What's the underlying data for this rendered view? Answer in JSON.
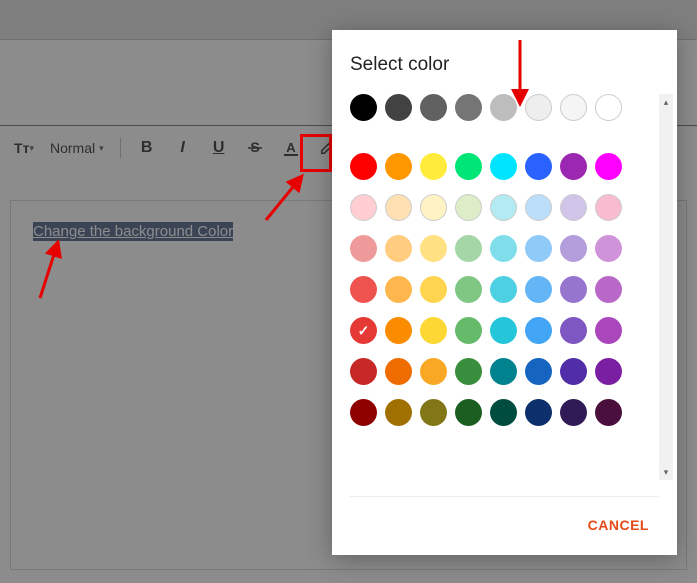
{
  "toolbar": {
    "font_size_icon": "Tт",
    "format_label": "Normal",
    "bold": "B",
    "italic": "I",
    "underline": "U"
  },
  "editor": {
    "selected_text": "Change the background Color"
  },
  "dialog": {
    "title": "Select color",
    "cancel_label": "CANCEL",
    "selected_color": "#e53935",
    "rows": [
      [
        {
          "c": "#000000"
        },
        {
          "c": "#424242"
        },
        {
          "c": "#616161"
        },
        {
          "c": "#757575"
        },
        {
          "c": "#bdbdbd"
        },
        {
          "c": "#eeeeee",
          "b": true
        },
        {
          "c": "#f5f5f5",
          "b": true
        },
        {
          "c": "#ffffff",
          "b": true
        }
      ],
      [
        {
          "c": "#ff0000"
        },
        {
          "c": "#ff9800"
        },
        {
          "c": "#ffeb3b"
        },
        {
          "c": "#00e676"
        },
        {
          "c": "#00e5ff"
        },
        {
          "c": "#2962ff"
        },
        {
          "c": "#9c27b0"
        },
        {
          "c": "#ff00ff"
        }
      ],
      [
        {
          "c": "#ffcdd2",
          "b": true
        },
        {
          "c": "#ffe0b2",
          "b": true
        },
        {
          "c": "#fff3c4",
          "b": true
        },
        {
          "c": "#dcedc8",
          "b": true
        },
        {
          "c": "#b2ebf2",
          "b": true
        },
        {
          "c": "#bbdefb",
          "b": true
        },
        {
          "c": "#d1c4e9",
          "b": true
        },
        {
          "c": "#f8bbd0",
          "b": true
        }
      ],
      [
        {
          "c": "#ef9a9a"
        },
        {
          "c": "#ffcc80"
        },
        {
          "c": "#ffe082"
        },
        {
          "c": "#a5d6a7"
        },
        {
          "c": "#80deea"
        },
        {
          "c": "#90caf9"
        },
        {
          "c": "#b39ddb"
        },
        {
          "c": "#ce93d8"
        }
      ],
      [
        {
          "c": "#ef5350"
        },
        {
          "c": "#ffb74d"
        },
        {
          "c": "#ffd54f"
        },
        {
          "c": "#81c784"
        },
        {
          "c": "#4dd0e1"
        },
        {
          "c": "#64b5f6"
        },
        {
          "c": "#9575cd"
        },
        {
          "c": "#ba68c8"
        }
      ],
      [
        {
          "c": "#e53935",
          "sel": true
        },
        {
          "c": "#fb8c00"
        },
        {
          "c": "#fdd835"
        },
        {
          "c": "#66bb6a"
        },
        {
          "c": "#26c6da"
        },
        {
          "c": "#42a5f5"
        },
        {
          "c": "#7e57c2"
        },
        {
          "c": "#ab47bc"
        }
      ],
      [
        {
          "c": "#c62828"
        },
        {
          "c": "#ef6c00"
        },
        {
          "c": "#f9a825"
        },
        {
          "c": "#388e3c"
        },
        {
          "c": "#00838f"
        },
        {
          "c": "#1565c0"
        },
        {
          "c": "#512da8"
        },
        {
          "c": "#7b1fa2"
        }
      ],
      [
        {
          "c": "#8e0000"
        },
        {
          "c": "#a07000"
        },
        {
          "c": "#827717"
        },
        {
          "c": "#1b5e20"
        },
        {
          "c": "#004d40"
        },
        {
          "c": "#0d2f6b"
        },
        {
          "c": "#311b57"
        },
        {
          "c": "#4a0f3d"
        }
      ]
    ]
  }
}
